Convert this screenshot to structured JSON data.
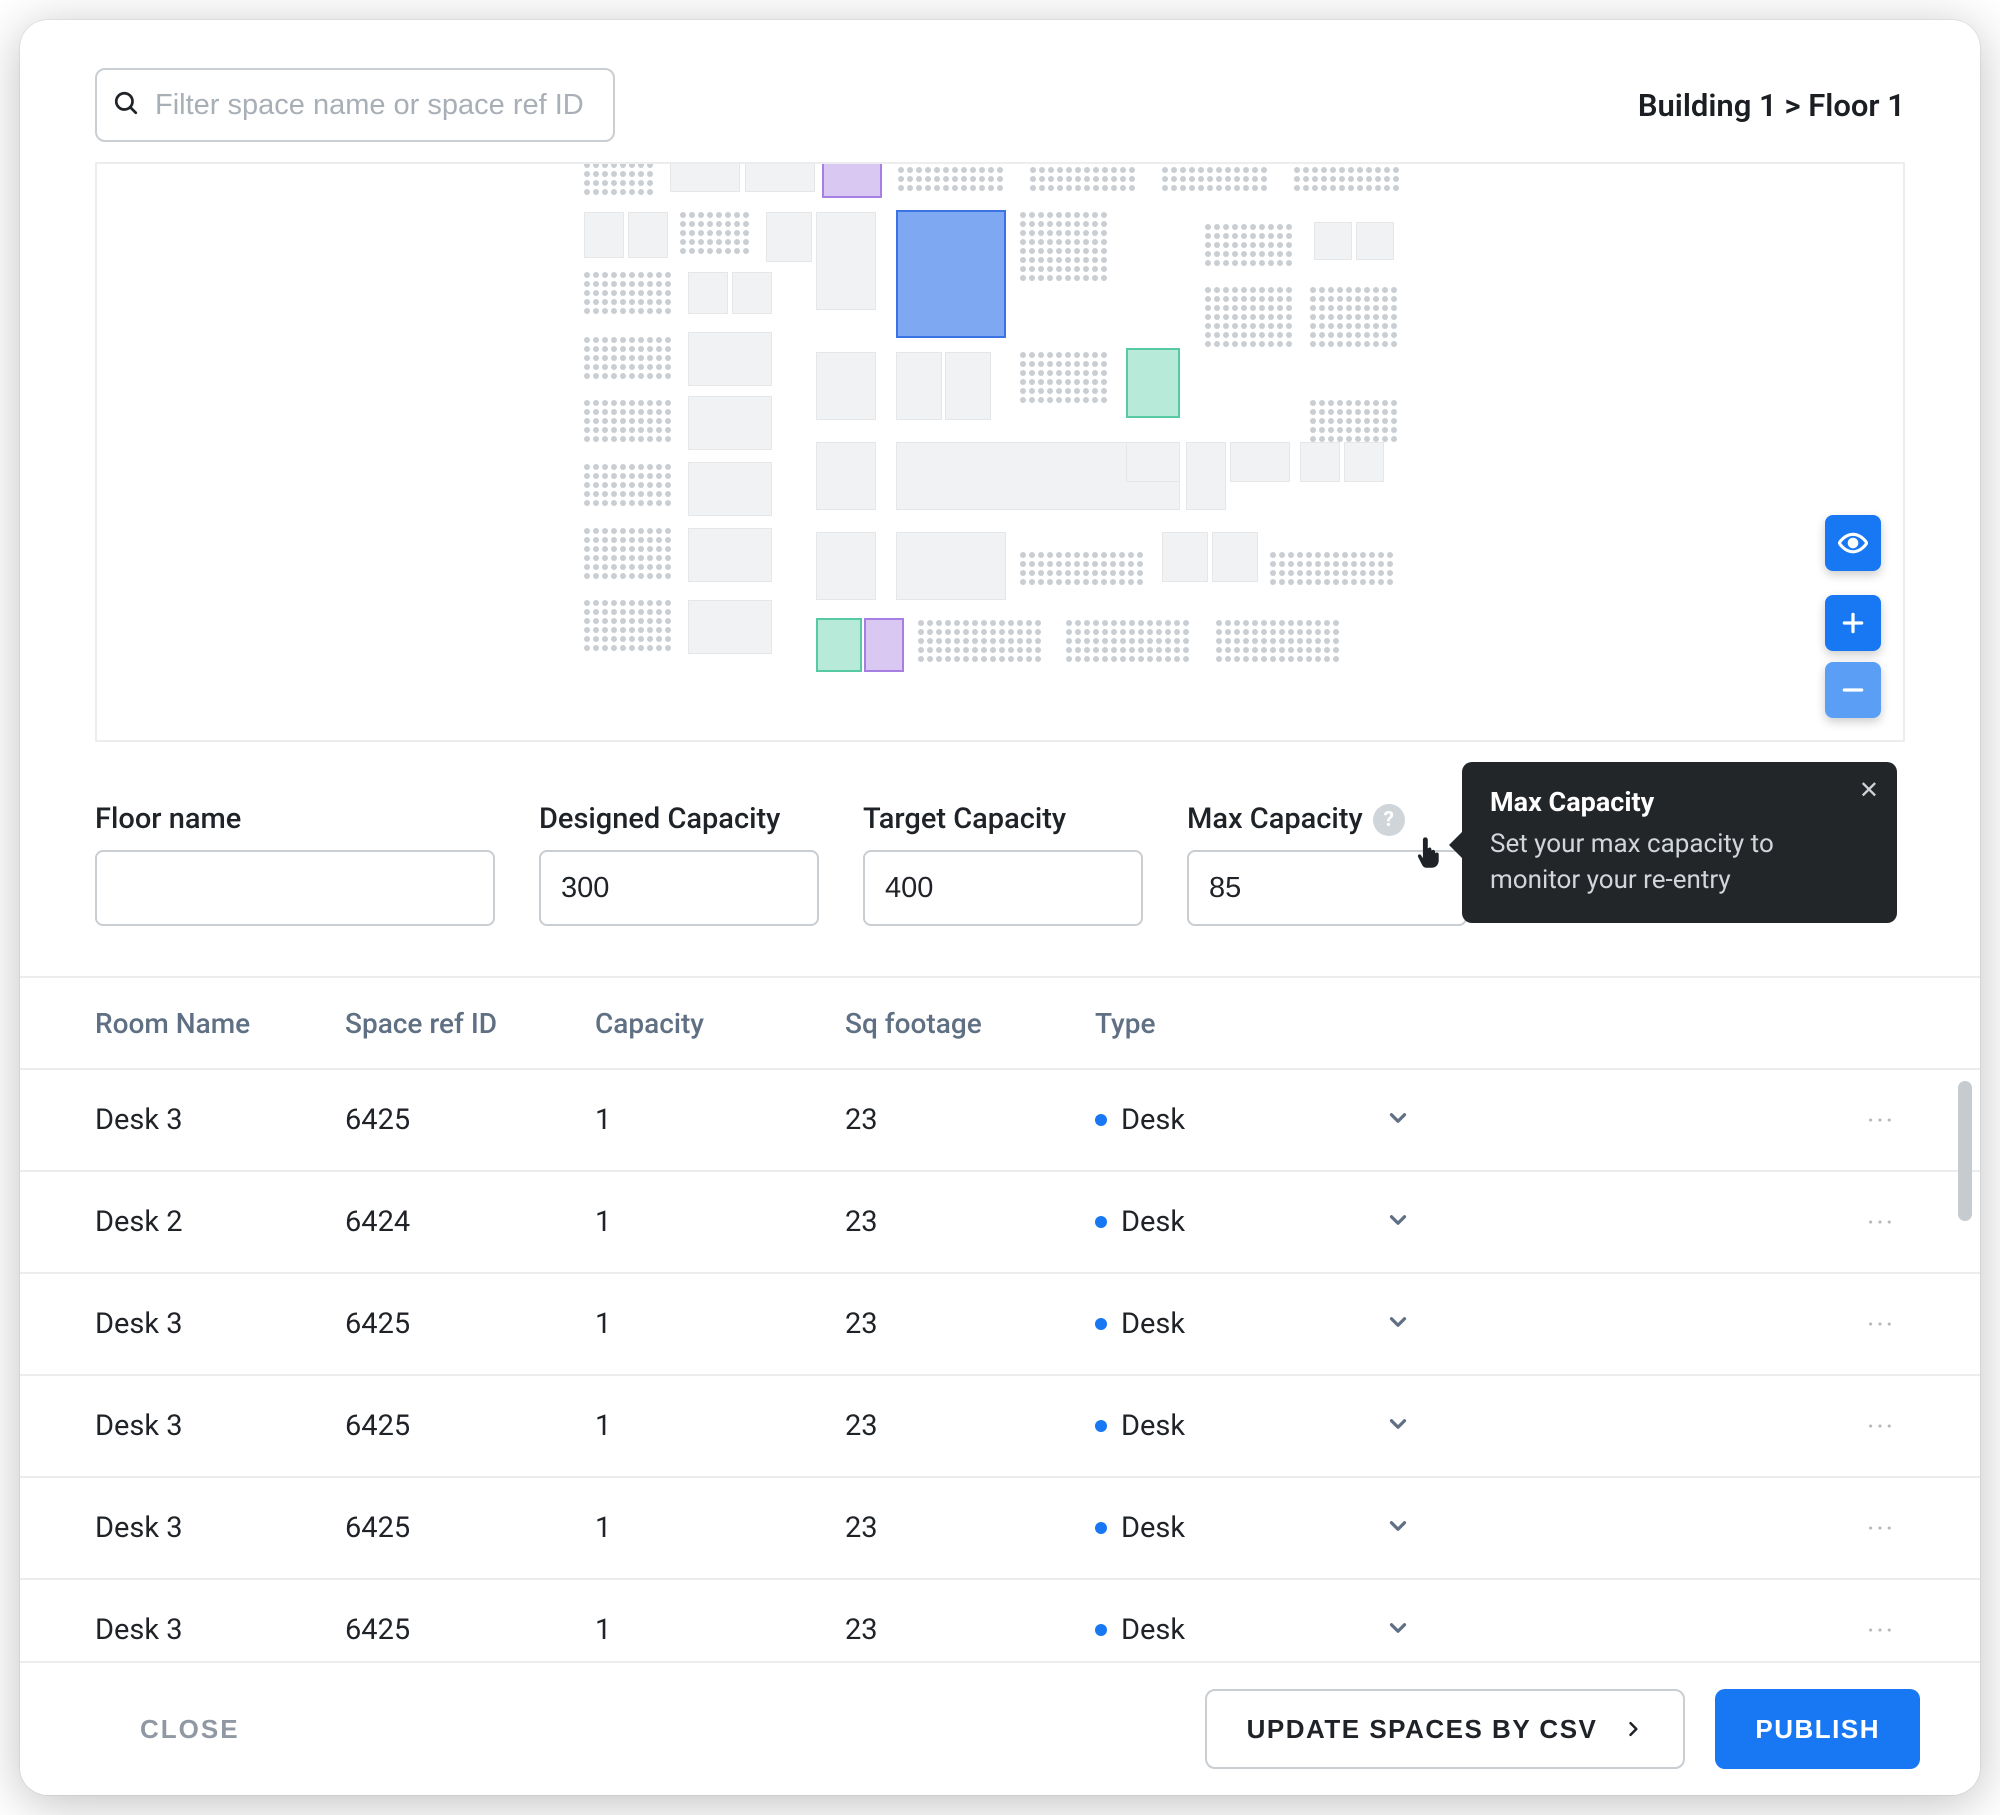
{
  "header": {
    "filter_placeholder": "Filter space name or space ref ID",
    "breadcrumb": "Building 1 > Floor 1"
  },
  "map_controls": {
    "view": "view-icon",
    "zoom_in": "+",
    "zoom_out": "−"
  },
  "capacity": {
    "floor_name": {
      "label": "Floor name",
      "value": ""
    },
    "designed": {
      "label": "Designed Capacity",
      "value": "300"
    },
    "target": {
      "label": "Target Capacity",
      "value": "400"
    },
    "max": {
      "label": "Max Capacity",
      "value": "85"
    }
  },
  "tooltip": {
    "title": "Max Capacity",
    "body": "Set your max capacity to monitor your re-entry"
  },
  "table": {
    "headers": {
      "room": "Room Name",
      "ref": "Space ref ID",
      "cap": "Capacity",
      "sq": "Sq footage",
      "type": "Type"
    },
    "rows": [
      {
        "room": "Desk 3",
        "ref": "6425",
        "cap": "1",
        "sq": "23",
        "type": "Desk"
      },
      {
        "room": "Desk 2",
        "ref": "6424",
        "cap": "1",
        "sq": "23",
        "type": "Desk"
      },
      {
        "room": "Desk 3",
        "ref": "6425",
        "cap": "1",
        "sq": "23",
        "type": "Desk"
      },
      {
        "room": "Desk 3",
        "ref": "6425",
        "cap": "1",
        "sq": "23",
        "type": "Desk"
      },
      {
        "room": "Desk 3",
        "ref": "6425",
        "cap": "1",
        "sq": "23",
        "type": "Desk"
      },
      {
        "room": "Desk 3",
        "ref": "6425",
        "cap": "1",
        "sq": "23",
        "type": "Desk"
      }
    ]
  },
  "footer": {
    "close": "CLOSE",
    "csv": "UPDATE SPACES BY CSV",
    "publish": "PUBLISH"
  },
  "colors": {
    "accent": "#1877f2",
    "hl_blue": "#7fa8f2",
    "hl_teal": "#b7ead9",
    "hl_purple": "#d9c8f2"
  }
}
